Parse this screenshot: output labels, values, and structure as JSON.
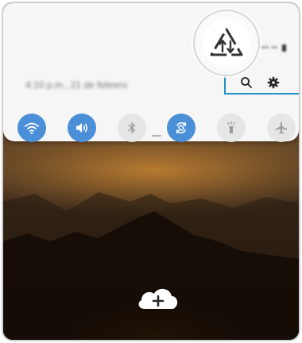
{
  "status_bar": {
    "right_text": "▪▪▪ ▪▪"
  },
  "panel": {
    "date_text": "4:10 p.m., 21 de febrero",
    "actions": [
      {
        "name": "search",
        "icon": "search-icon"
      },
      {
        "name": "settings",
        "icon": "gear-icon"
      }
    ],
    "toggles": [
      {
        "name": "wifi",
        "icon": "wifi-icon",
        "state": "on"
      },
      {
        "name": "sound",
        "icon": "volume-icon",
        "state": "on"
      },
      {
        "name": "bluetooth",
        "icon": "bluetooth-icon",
        "state": "off"
      },
      {
        "name": "auto-rotate",
        "icon": "rotate-icon",
        "state": "on"
      },
      {
        "name": "flashlight",
        "icon": "flashlight-icon",
        "state": "off"
      },
      {
        "name": "airplane",
        "icon": "airplane-icon",
        "state": "off"
      }
    ]
  },
  "callout": {
    "icon": "data-saver-icon"
  },
  "home": {
    "add_icon": "cloud-add-icon"
  },
  "colors": {
    "toggle_on": "#4a8fd8",
    "toggle_off": "#e6e6e6",
    "callout_line": "#1e90c8",
    "panel_bg": "#f6f6f6"
  }
}
